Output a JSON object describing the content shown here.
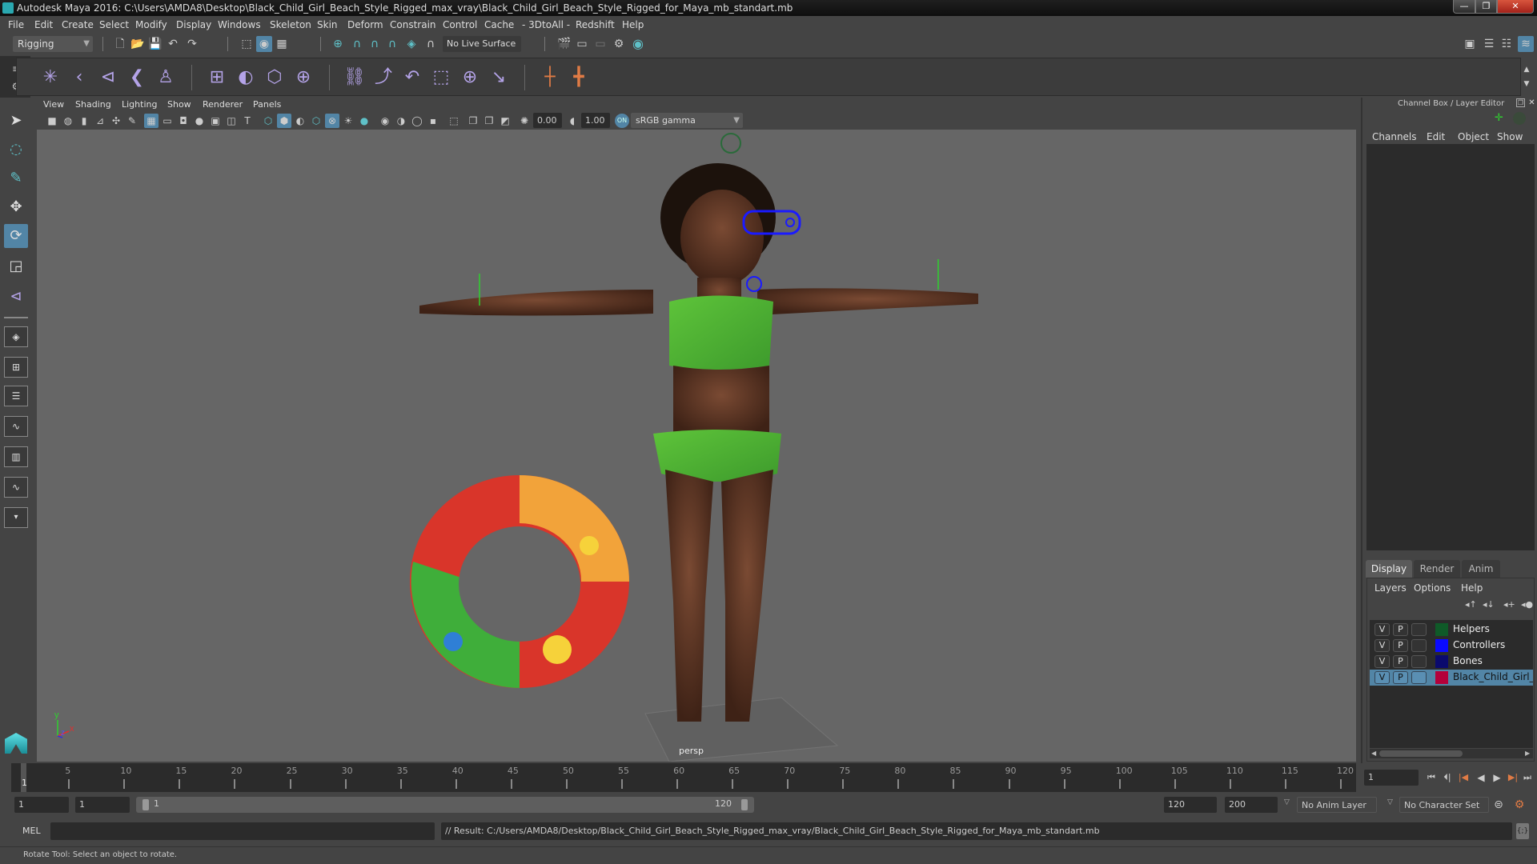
{
  "window": {
    "title": "Autodesk Maya 2016: C:\\Users\\AMDA8\\Desktop\\Black_Child_Girl_Beach_Style_Rigged_max_vray\\Black_Child_Girl_Beach_Style_Rigged_for_Maya_mb_standart.mb",
    "minimize": "—",
    "maximize": "❐",
    "close": "✕"
  },
  "menubar": [
    "File",
    "Edit",
    "Create",
    "Select",
    "Modify",
    "Display",
    "Windows",
    "Skeleton",
    "Skin",
    "Deform",
    "Constrain",
    "Control",
    "Cache",
    "- 3DtoAll -",
    "Redshift",
    "Help"
  ],
  "statusline": {
    "menuset": "Rigging",
    "live_surface": "No Live Surface"
  },
  "shelf": {
    "icons": [
      "joint-tool-icon",
      "ik-handle-icon",
      "ik-spline-icon",
      "insert-joint-icon",
      "quick-rig-icon",
      "bind-skin-icon",
      "paint-weights-icon",
      "lattice-icon",
      "cluster-icon",
      "parent-constraint-icon",
      "point-constraint-icon",
      "orient-constraint-icon",
      "scale-constraint-icon",
      "aim-constraint-icon",
      "pole-vector-icon",
      "locator-icon",
      "locator-2-icon"
    ]
  },
  "panel_menu": [
    "View",
    "Shading",
    "Lighting",
    "Show",
    "Renderer",
    "Panels"
  ],
  "viewport_toolbar": {
    "exposure": "0.00",
    "gamma": "1.00",
    "color_space": "sRGB gamma"
  },
  "viewport": {
    "camera_label": "persp",
    "axis": {
      "x": "x",
      "y": "y",
      "z": "z"
    }
  },
  "channel_box": {
    "title": "Channel Box / Layer Editor",
    "menu": [
      "Channels",
      "Edit",
      "Object",
      "Show"
    ]
  },
  "layer_editor": {
    "tabs": [
      "Display",
      "Render",
      "Anim"
    ],
    "active_tab": "Display",
    "menu": [
      "Layers",
      "Options",
      "Help"
    ],
    "layers": [
      {
        "v": "V",
        "p": "P",
        "name": "Helpers",
        "color": "#0f5a28",
        "selected": false
      },
      {
        "v": "V",
        "p": "P",
        "name": "Controllers",
        "color": "#0a0aff",
        "selected": false
      },
      {
        "v": "V",
        "p": "P",
        "name": "Bones",
        "color": "#0a0a6e",
        "selected": false
      },
      {
        "v": "V",
        "p": "P",
        "name": "Black_Child_Girl_Beach",
        "color": "#b4003a",
        "selected": true
      }
    ]
  },
  "timeline": {
    "ticks": [
      1,
      5,
      10,
      15,
      20,
      25,
      30,
      35,
      40,
      45,
      50,
      55,
      60,
      65,
      70,
      75,
      80,
      85,
      90,
      95,
      100,
      105,
      110,
      115,
      120
    ],
    "start": 1,
    "end": 120,
    "current_frame": "1"
  },
  "range": {
    "anim_start": "1",
    "playback_start": "1",
    "slider_start": "1",
    "slider_end": "120",
    "playback_end": "120",
    "anim_end": "200",
    "anim_layer": "No Anim Layer",
    "character_set": "No Character Set"
  },
  "command_line": {
    "language": "MEL",
    "input": "",
    "result": "// Result: C:/Users/AMDA8/Desktop/Black_Child_Girl_Beach_Style_Rigged_max_vray/Black_Child_Girl_Beach_Style_Rigged_for_Maya_mb_standart.mb"
  },
  "help_line": "Rotate Tool: Select an object to rotate."
}
